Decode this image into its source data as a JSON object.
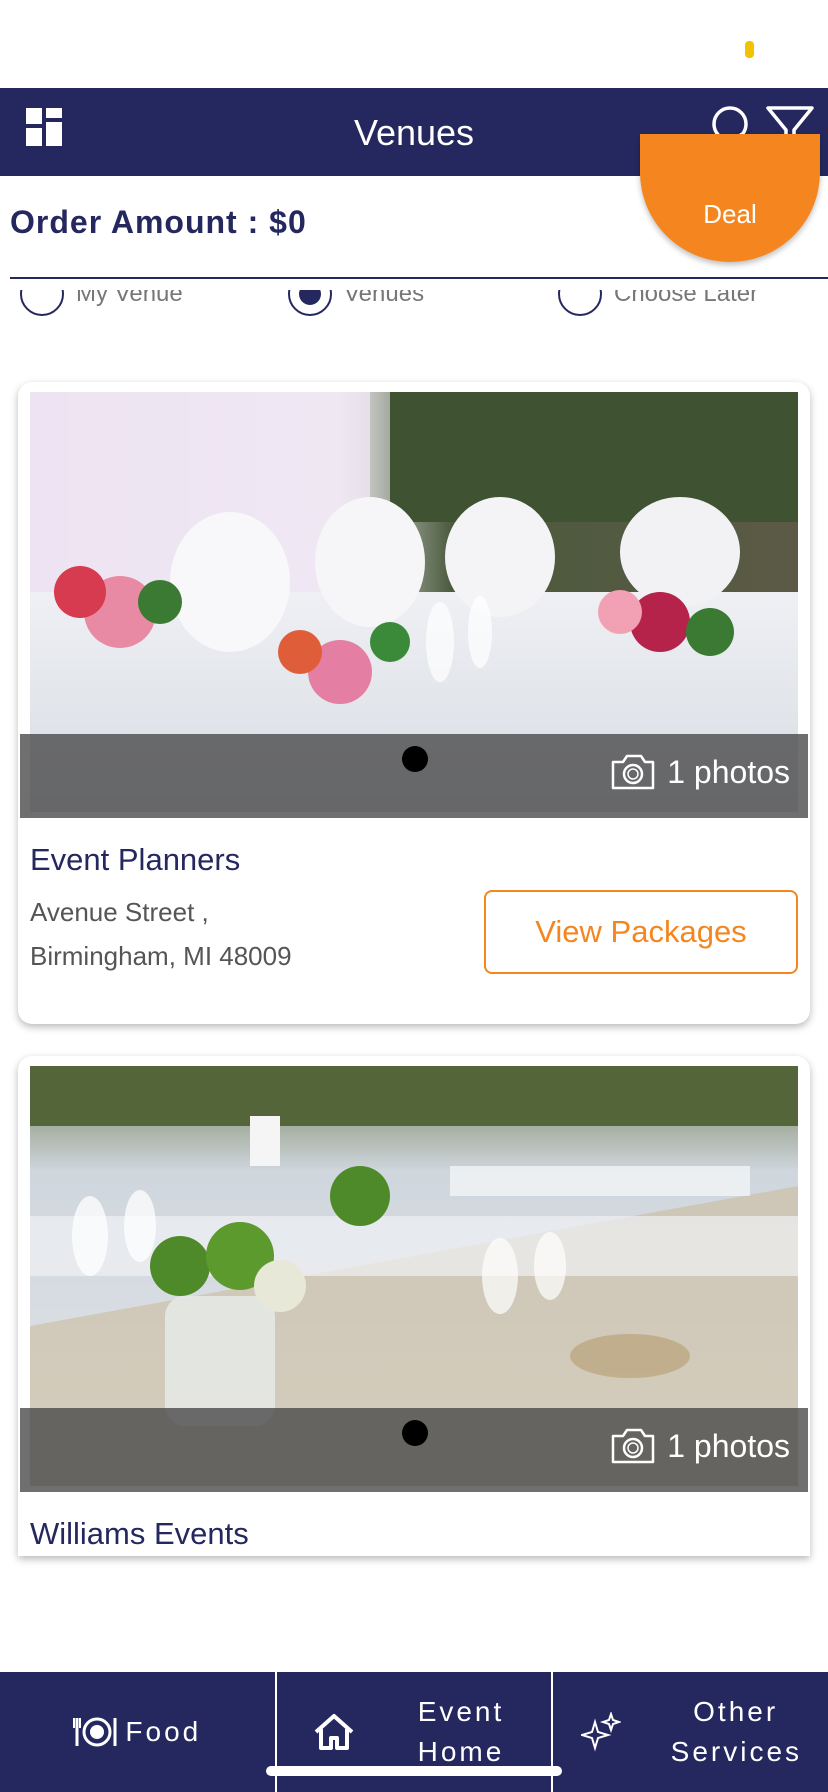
{
  "app": {
    "title": "Venues",
    "deal_label": "Deal",
    "order_amount": "Order Amount : $0"
  },
  "venue_options": [
    {
      "label": "My Venue",
      "selected": false
    },
    {
      "label": "Venues",
      "selected": true
    },
    {
      "label": "Choose Later",
      "selected": false
    }
  ],
  "venues": [
    {
      "name": "Event Planners",
      "address_line1": "Avenue Street ,",
      "address_line2": "Birmingham, MI 48009",
      "photo_count": "1 photos",
      "button_label": "View Packages"
    },
    {
      "name": "Williams Events",
      "photo_count": "1 photos"
    }
  ],
  "bottom_nav": [
    {
      "label": "Food",
      "icon": "food-plate-icon"
    },
    {
      "label": "Event Home",
      "icon": "home-icon"
    },
    {
      "label": "Other Services",
      "icon": "sparkle-icon"
    }
  ],
  "colors": {
    "primary": "#25285f",
    "accent": "#f5861f",
    "status_dot": "#f2c200"
  }
}
